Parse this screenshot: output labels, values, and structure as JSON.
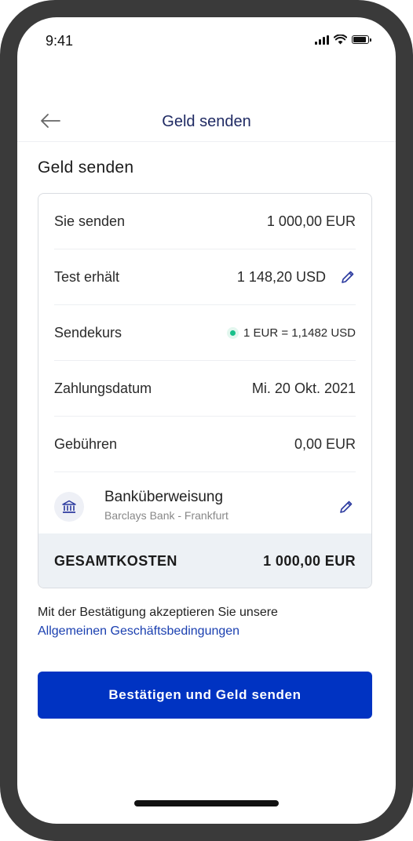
{
  "status_bar": {
    "time": "9:41"
  },
  "header": {
    "title": "Geld senden",
    "back_icon": "arrow-left-icon"
  },
  "section_title": "Geld senden",
  "summary": {
    "rows": [
      {
        "label": "Sie senden",
        "value": "1 000,00 EUR"
      },
      {
        "label": "Test erhält",
        "value": "1 148,20 USD"
      },
      {
        "label": "Sendekurs",
        "value": "1 EUR = 1,1482 USD"
      },
      {
        "label": "Zahlungsdatum",
        "value": "Mi. 20 Okt. 2021"
      },
      {
        "label": "Gebühren",
        "value": "0,00 EUR"
      }
    ],
    "payment_method": {
      "title": "Banküberweisung",
      "subtitle": "Barclays Bank - Frankfurt",
      "icon": "bank-icon"
    },
    "total": {
      "label": "GESAMTKOSTEN",
      "value": "1 000,00 EUR"
    }
  },
  "terms": {
    "text": "Mit der Bestätigung akzeptieren Sie unsere",
    "link": "Allgemeinen Geschäftsbedingungen"
  },
  "confirm_button": {
    "label": "Bestätigen und Geld senden"
  },
  "colors": {
    "primary": "#0033c2",
    "link": "#1a3fb0",
    "title": "#1f2a63",
    "rate_dot": "#19c08b",
    "total_bg": "#edf1f5"
  }
}
